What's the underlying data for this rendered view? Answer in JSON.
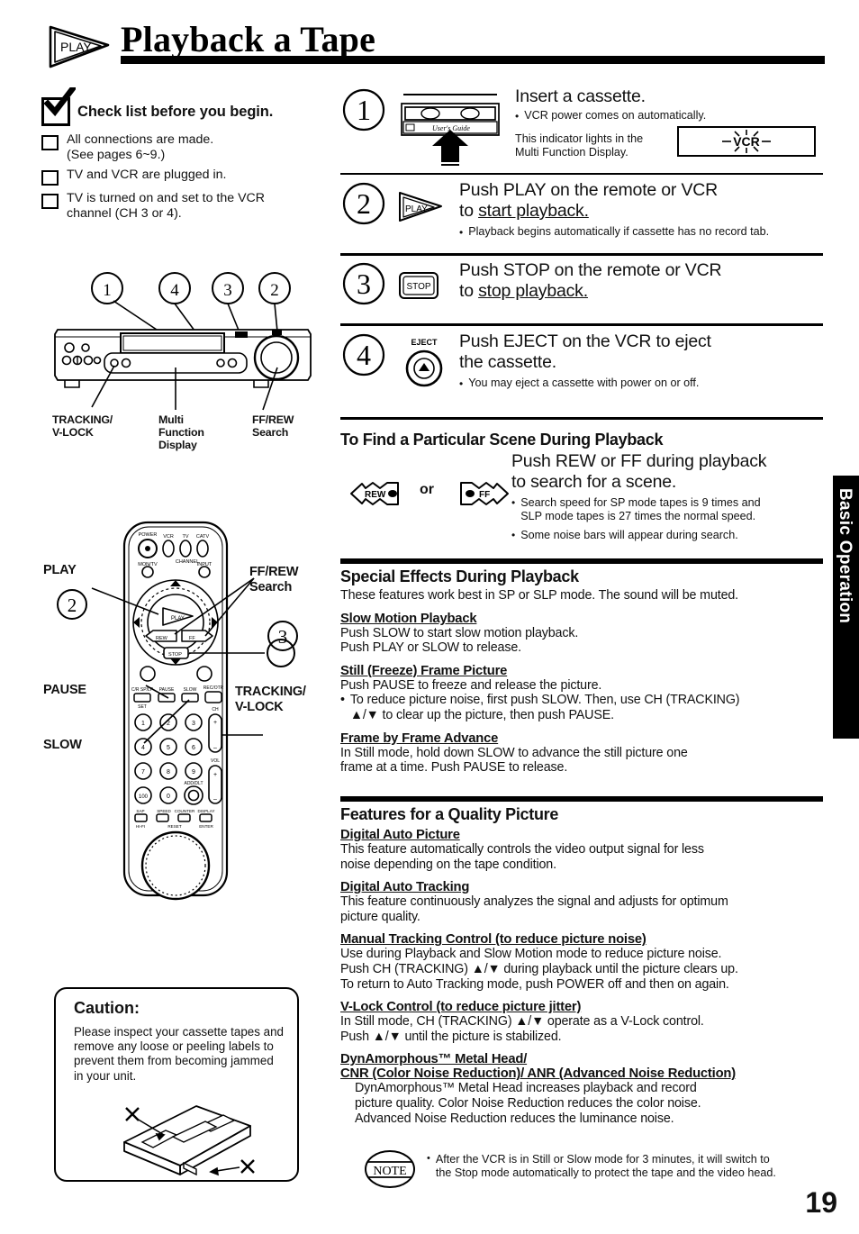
{
  "header": {
    "title": "Playback a Tape",
    "play_logo_label": "PLAY"
  },
  "checklist": {
    "heading": "Check list before you begin.",
    "items": [
      "All connections are made.\n(See pages 6~9.)",
      "TV and VCR are plugged in.",
      "TV is turned on and set to the VCR\nchannel (CH 3 or 4)."
    ]
  },
  "vcr_diagram": {
    "callout_numbers": [
      "1",
      "4",
      "3",
      "2"
    ],
    "captions": [
      "TRACKING/\nV-LOCK",
      "Multi\nFunction\nDisplay",
      "FF/REW\nSearch"
    ]
  },
  "remote_diagram": {
    "labels": {
      "play": "PLAY",
      "pause": "PAUSE",
      "slow": "SLOW",
      "ffrew": "FF/REW\nSearch",
      "tracking": "TRACKING/\nV-LOCK"
    },
    "callout_play": "2",
    "callout_stop": "3",
    "keys": {
      "power": "POWER",
      "vcr": "VCR",
      "tv": "TV",
      "catv": "CATV",
      "monitor": "MON/TV",
      "input": "INPUT",
      "play": "PLAY",
      "rew": "REW",
      "ff": "FF",
      "stop": "STOP",
      "cancel": "CH",
      "pause": "PAUSE",
      "slow": "SLOW",
      "rec": "REC",
      "vol": "VOL",
      "add_dlt": "ADD/DLT"
    }
  },
  "caution": {
    "title": "Caution:",
    "text": "Please inspect your cassette tapes and remove any loose or peeling labels to prevent them from becoming jammed in your unit."
  },
  "steps": [
    {
      "number": "1",
      "icon": "cassette-insert-icon",
      "title": "Insert a cassette.",
      "bullets": [
        "VCR power comes on automatically."
      ],
      "indicator_note": "This indicator lights in the\nMulti Function Display.",
      "indicator_label": "VCR"
    },
    {
      "number": "2",
      "icon": "play-button-icon",
      "icon_label": "PLAY",
      "title_line1": "Push PLAY on the remote or VCR",
      "title_line2_prefix": "to ",
      "title_line2_underlined": "start playback.",
      "bullets": [
        "Playback begins automatically if cassette has no record tab."
      ]
    },
    {
      "number": "3",
      "icon": "stop-button-icon",
      "icon_label": "STOP",
      "title_line1": "Push STOP on the remote or VCR",
      "title_line2_prefix": "to ",
      "title_line2_underlined": "stop playback.",
      "bullets": []
    },
    {
      "number": "4",
      "icon": "eject-button-icon",
      "icon_label": "EJECT",
      "title_line1": "Push EJECT on the VCR to eject",
      "title_line2_prefix": "the cassette.",
      "title_line2_underlined": "",
      "bullets": [
        "You may eject a cassette with power on or off."
      ]
    }
  ],
  "find_scene": {
    "heading": "To Find a Particular Scene During Playback",
    "rew_label": "REW",
    "or_label": "or",
    "ff_label": "FF",
    "line1": "Push REW or FF during playback",
    "line2": "to search for a scene.",
    "bullets": [
      "Search speed for SP mode tapes is 9 times and\nSLP mode tapes is 27 times the normal speed.",
      "Some noise bars will appear during search."
    ]
  },
  "special_effects": {
    "heading": "Special Effects During Playback",
    "intro": "These features work best in SP or SLP mode. The sound will be muted.",
    "subsections": [
      {
        "title": "Slow Motion Playback",
        "lines": [
          "Push SLOW to start slow motion playback.",
          "Push PLAY or SLOW to release."
        ],
        "bullets": []
      },
      {
        "title": "Still (Freeze) Frame Picture",
        "lines": [
          "Push PAUSE to freeze and release the picture."
        ],
        "bullets": [
          "To reduce picture noise, first push SLOW. Then, use CH (TRACKING)\n▲/▼ to clear up the picture, then push PAUSE."
        ]
      },
      {
        "title": "Frame by Frame Advance",
        "lines": [
          "In Still mode, hold down SLOW to advance the still picture one",
          "frame at a time. Push PAUSE to release."
        ],
        "bullets": []
      }
    ]
  },
  "quality_features": {
    "heading": "Features for a Quality Picture",
    "subsections": [
      {
        "title": "Digital Auto Picture",
        "lines": [
          "This feature automatically controls the video output signal for less",
          "noise depending on the tape condition."
        ]
      },
      {
        "title": "Digital Auto Tracking",
        "lines": [
          "This feature continuously analyzes the signal and adjusts for optimum",
          "picture quality."
        ]
      },
      {
        "title": "Manual Tracking Control (to reduce picture noise)",
        "lines": [
          "Use during Playback and Slow Motion mode to reduce picture noise.",
          "Push CH (TRACKING) ▲/▼ during playback until the picture clears up.",
          "To return to Auto Tracking mode, push POWER off and then on again."
        ]
      },
      {
        "title": "V-Lock Control (to reduce picture jitter)",
        "lines": [
          "In Still mode, CH (TRACKING) ▲/▼ operate as a V-Lock control.",
          "Push ▲/▼ until the picture is stabilized."
        ]
      },
      {
        "title": "DynAmorphous™ Metal Head/",
        "title2": "CNR (Color Noise Reduction)/ ANR (Advanced Noise Reduction)",
        "lines": [
          "DynAmorphous™ Metal Head increases playback and record",
          "picture quality. Color Noise Reduction reduces the color noise.",
          "Advanced Noise Reduction reduces the luminance noise."
        ]
      }
    ]
  },
  "note": {
    "badge": "NOTE",
    "text": "After the VCR is in Still or Slow mode for 3 minutes, it will switch to\nthe Stop mode automatically to protect the tape and the video head."
  },
  "side_tab": {
    "label": "Basic Operation"
  },
  "page_number": "19",
  "colors": {
    "ink": "#111111",
    "paper": "#ffffff",
    "tab_bg": "#000000",
    "tab_fg": "#ffffff"
  }
}
